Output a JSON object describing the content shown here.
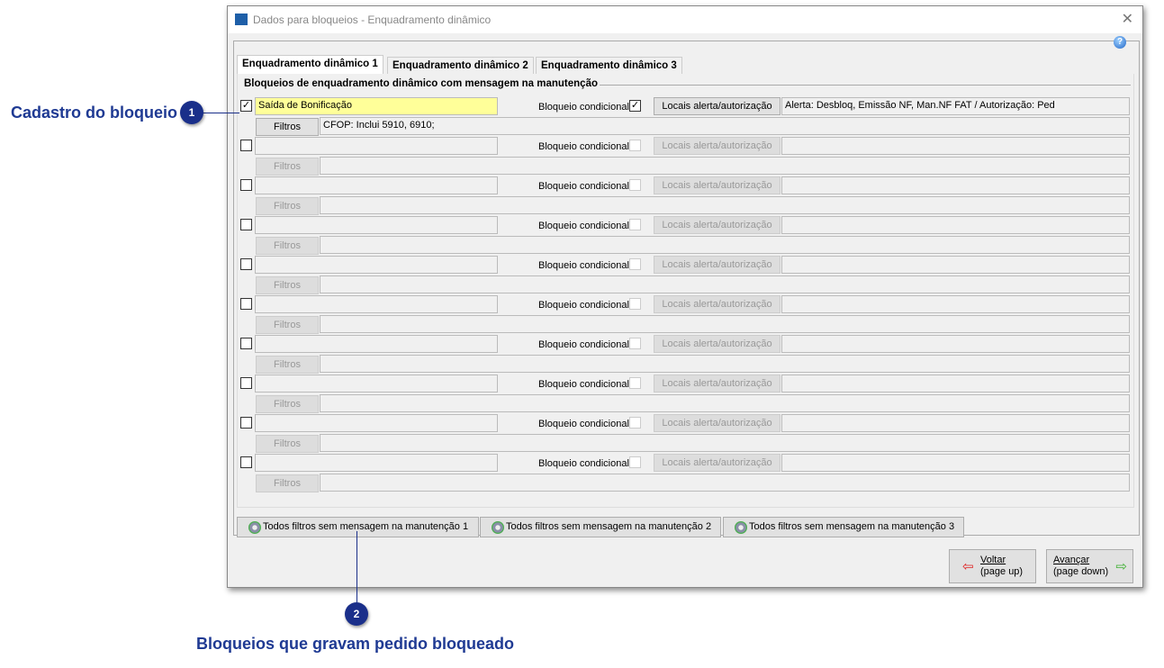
{
  "window": {
    "title": "Dados para bloqueios - Enquadramento dinâmico",
    "close_icon": "close-icon",
    "help_icon": "help-icon"
  },
  "tabs": [
    {
      "label": "Enquadramento dinâmico 1",
      "active": true
    },
    {
      "label": "Enquadramento dinâmico 2"
    },
    {
      "label": "Enquadramento dinâmico 3"
    }
  ],
  "group_title": "Bloqueios de enquadramento dinâmico com mensagem na manutenção",
  "labels": {
    "conditional": "Bloqueio condicional",
    "locais": "Locais alerta/autorização",
    "filtros": "Filtros"
  },
  "rows": [
    {
      "enabled": true,
      "name": "Saída de Bonificação",
      "conditional": true,
      "alert": "Alerta: Desbloq, Emissão NF, Man.NF FAT / Autorização: Ped",
      "filters": "CFOP: Inclui 5910, 6910;"
    },
    {
      "enabled": false,
      "name": "",
      "conditional": false,
      "alert": "",
      "filters": ""
    },
    {
      "enabled": false,
      "name": "",
      "conditional": false,
      "alert": "",
      "filters": ""
    },
    {
      "enabled": false,
      "name": "",
      "conditional": false,
      "alert": "",
      "filters": ""
    },
    {
      "enabled": false,
      "name": "",
      "conditional": false,
      "alert": "",
      "filters": ""
    },
    {
      "enabled": false,
      "name": "",
      "conditional": false,
      "alert": "",
      "filters": ""
    },
    {
      "enabled": false,
      "name": "",
      "conditional": false,
      "alert": "",
      "filters": ""
    },
    {
      "enabled": false,
      "name": "",
      "conditional": false,
      "alert": "",
      "filters": ""
    },
    {
      "enabled": false,
      "name": "",
      "conditional": false,
      "alert": "",
      "filters": ""
    },
    {
      "enabled": false,
      "name": "",
      "conditional": false,
      "alert": "",
      "filters": ""
    }
  ],
  "bottom_buttons": [
    "Todos filtros sem mensagem na manutenção 1",
    "Todos filtros sem mensagem na manutenção 2",
    "Todos filtros sem mensagem na manutenção 3"
  ],
  "nav": {
    "back_line1": "Voltar",
    "back_line2": "(page up)",
    "next_line1": "Avançar",
    "next_line2": "(page down)"
  },
  "annotations": {
    "a1_number": "1",
    "a1_text": "Cadastro do bloqueio",
    "a2_number": "2",
    "a2_text": "Bloqueios que gravam pedido bloqueado"
  },
  "colors": {
    "annotation": "#1f3a93",
    "highlight_field": "#ffff99"
  }
}
